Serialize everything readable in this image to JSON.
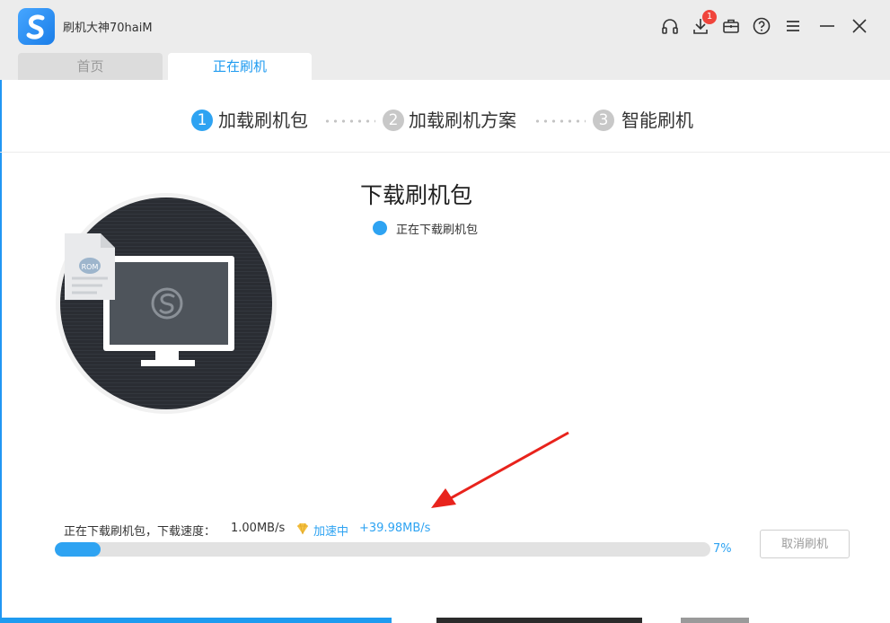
{
  "window": {
    "title": "刷机大神70haiM"
  },
  "titlebar": {
    "icons": [
      "headset-icon",
      "download-icon",
      "toolbox-icon",
      "help-icon",
      "menu-icon",
      "minimize-icon",
      "close-icon"
    ],
    "download_badge": "1"
  },
  "tabs": [
    {
      "label": "首页",
      "active": false
    },
    {
      "label": "正在刷机",
      "active": true
    }
  ],
  "steps": [
    {
      "num": "1",
      "label": "加载刷机包",
      "active": true
    },
    {
      "num": "2",
      "label": "加载刷机方案",
      "active": false
    },
    {
      "num": "3",
      "label": "智能刷机",
      "active": false
    }
  ],
  "main": {
    "title": "下载刷机包",
    "status": "正在下载刷机包",
    "rom_label": "ROM"
  },
  "progress": {
    "status_text": "正在下载刷机包，下载速度：",
    "speed": "1.00MB/s",
    "accel_label": "加速中",
    "accel_speed": "+39.98MB/s",
    "percent_label": "7%",
    "fraction": 0.07
  },
  "actions": {
    "cancel_label": "取消刷机"
  },
  "colors": {
    "accent": "#2ea3f2",
    "inactive_step": "#c8c8c8",
    "badge": "#f0443b"
  }
}
